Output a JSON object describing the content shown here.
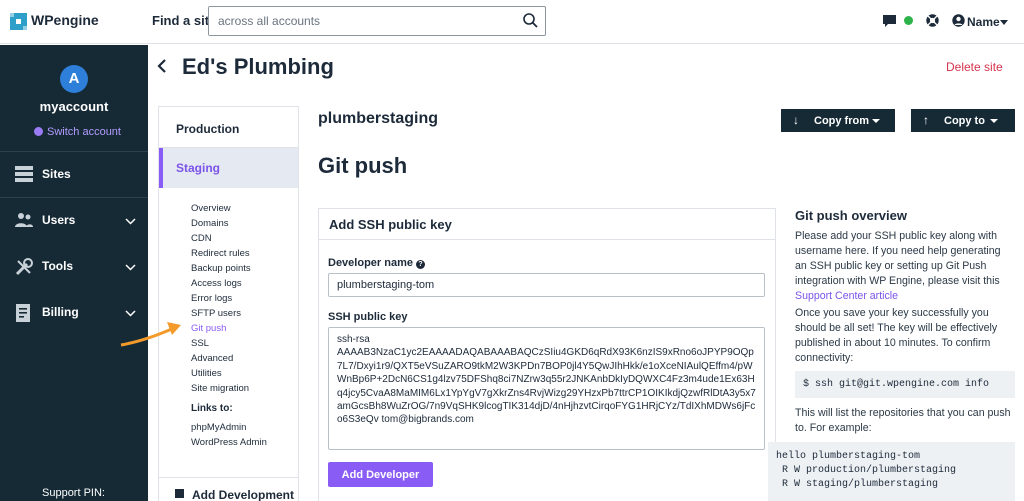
{
  "brand": {
    "logo_text": "WPengine"
  },
  "search": {
    "label": "Find a site",
    "placeholder": "across all accounts"
  },
  "topbar": {
    "user_name": "Name"
  },
  "sidebar": {
    "avatar_letter": "A",
    "account_name": "myaccount",
    "switch_account": "Switch account",
    "items": [
      {
        "label": "Sites",
        "icon": "grid-icon"
      },
      {
        "label": "Users",
        "icon": "users-icon"
      },
      {
        "label": "Tools",
        "icon": "tools-icon"
      },
      {
        "label": "Billing",
        "icon": "billing-icon"
      }
    ],
    "support_pin": "Support PIN:"
  },
  "header": {
    "site_title": "Ed's Plumbing",
    "delete_site": "Delete site"
  },
  "env_nav": {
    "production": "Production",
    "staging": "Staging",
    "links": [
      "Overview",
      "Domains",
      "CDN",
      "Redirect rules",
      "Backup points",
      "Access logs",
      "Error logs",
      "SFTP users",
      "Git push",
      "SSL",
      "Advanced",
      "Utilities",
      "Site migration"
    ],
    "active_link": "Git push",
    "links_to_heading": "Links to:",
    "external_links": [
      "phpMyAdmin",
      "WordPress Admin"
    ],
    "add_development": "Add Development"
  },
  "main": {
    "env_name": "plumberstaging",
    "copy_from": "Copy from",
    "copy_to": "Copy to",
    "page_heading": "Git push"
  },
  "form": {
    "title": "Add SSH public key",
    "developer_name_label": "Developer name",
    "developer_name_value": "plumberstaging-tom",
    "ssh_key_label": "SSH public key",
    "ssh_key_value": "ssh-rsa\nAAAAB3NzaC1yc2EAAAADAQABAAABAQCzSIiu4GKD6qRdX93K6nzIS9xRno6oJPYP9OQp7L7/Dxyi1r9/QXT5eVSuZARO9tkM2W3KPDn7BOP0jl4Y5QwJIhHkk/e1oXceNIAulQEffm4/pWWnBp6P+2DcN6CS1g4lzv75DFShq8ci7NZrw3q55r2JNKAnbDkIyDQWXC4Fz3m4ude1Ex63Hq4jcy5CvaA8MaMIM6Lx1YpYgV7gXkrZns4RvjWizg29YHzxPb7ttrCP1OIKIkdjQzwfRlDtA3y5x7amGcsBh8WuZrOG/7n9VqSHK9lcogTIK314djD/4nHjhzvtCirqoFYG1HRjCYz/TdIXhMDWs6jFco6S3eQv tom@bigbrands.com",
    "add_button": "Add Developer"
  },
  "overview": {
    "title": "Git push overview",
    "p1": "Please add your SSH public key along with username here. If you need help generating an SSH public key or setting up Git Push integration with WP Engine, please visit this ",
    "p1_link": "Support Center article",
    "p2": "Once you save your key successfully you should be all set! The key will be effectively published in about 10 minutes. To confirm connectivity:",
    "code1": "$ ssh git@git.wpengine.com info",
    "p3": "This will list the repositories that you can push to. For example:",
    "code2": "hello plumberstaging-tom\n R W production/plumberstaging\n R W staging/plumberstaging"
  },
  "colors": {
    "accent": "#8a5cf6",
    "sidebar_bg": "#162a36",
    "danger": "#d6334c",
    "arrow": "#f39a2b"
  }
}
